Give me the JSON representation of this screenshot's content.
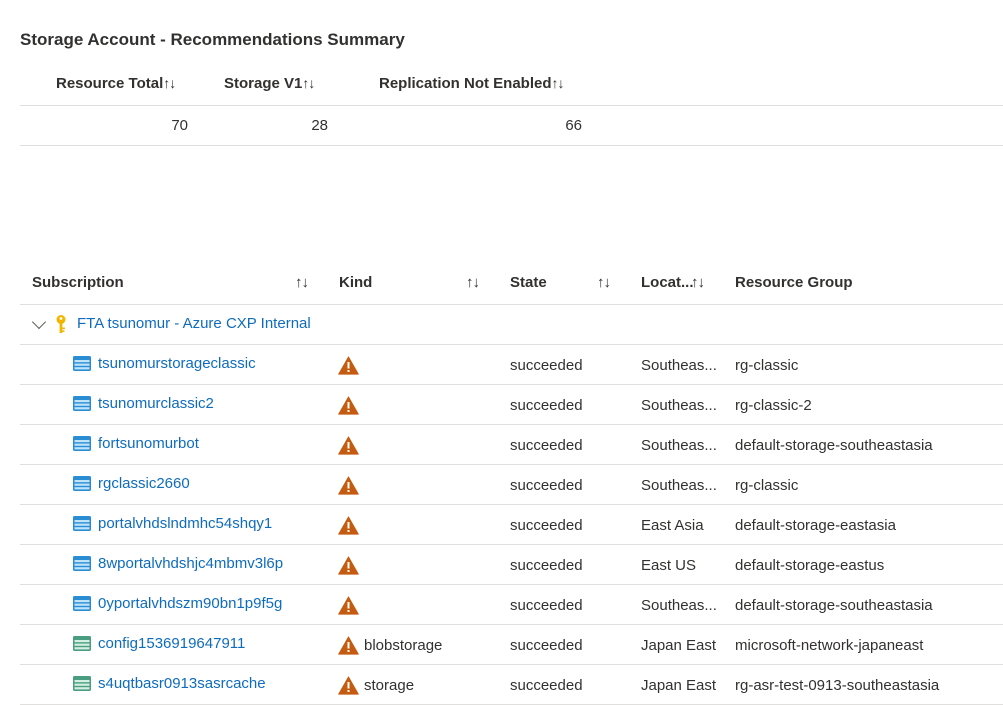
{
  "summary": {
    "title": "Storage Account - Recommendations Summary",
    "columns": [
      {
        "label": "Resource Total",
        "sort": "↑↓"
      },
      {
        "label": "Storage V1",
        "sort": "↑↓"
      },
      {
        "label": "Replication Not Enabled",
        "sort": "↑↓"
      }
    ],
    "values": [
      "70",
      "28",
      "66"
    ]
  },
  "grid": {
    "columns": [
      {
        "label": "Subscription",
        "sort": "↑↓"
      },
      {
        "label": "Kind",
        "sort": "↑↓"
      },
      {
        "label": "State",
        "sort": "↑↓"
      },
      {
        "label": "Locat...",
        "sort": "↑↓"
      },
      {
        "label": "Resource Group"
      }
    ],
    "group": {
      "label": "FTA tsunomur - Azure CXP Internal",
      "icon": "key-icon",
      "expanded": true
    },
    "rows": [
      {
        "name": "tsunomurstorageclassic",
        "icon": "storage-classic-icon",
        "kind": "",
        "state": "succeeded",
        "location": "Southeas...",
        "resource_group": "rg-classic"
      },
      {
        "name": "tsunomurclassic2",
        "icon": "storage-classic-icon",
        "kind": "",
        "state": "succeeded",
        "location": "Southeas...",
        "resource_group": "rg-classic-2"
      },
      {
        "name": "fortsunomurbot",
        "icon": "storage-classic-icon",
        "kind": "",
        "state": "succeeded",
        "location": "Southeas...",
        "resource_group": "default-storage-southeastasia"
      },
      {
        "name": "rgclassic2660",
        "icon": "storage-classic-icon",
        "kind": "",
        "state": "succeeded",
        "location": "Southeas...",
        "resource_group": "rg-classic"
      },
      {
        "name": "portalvhdslndmhc54shqy1",
        "icon": "storage-classic-icon",
        "kind": "",
        "state": "succeeded",
        "location": "East Asia",
        "resource_group": "default-storage-eastasia"
      },
      {
        "name": "8wportalvhdshjc4mbmv3l6p",
        "icon": "storage-classic-icon",
        "kind": "",
        "state": "succeeded",
        "location": "East US",
        "resource_group": "default-storage-eastus"
      },
      {
        "name": "0yportalvhdszm90bn1p9f5g",
        "icon": "storage-classic-icon",
        "kind": "",
        "state": "succeeded",
        "location": "Southeas...",
        "resource_group": "default-storage-southeastasia"
      },
      {
        "name": "config1536919647911",
        "icon": "storage-account-icon",
        "kind": "blobstorage",
        "state": "succeeded",
        "location": "Japan East",
        "resource_group": "microsoft-network-japaneast"
      },
      {
        "name": "s4uqtbasr0913sasrcache",
        "icon": "storage-account-icon",
        "kind": "storage",
        "state": "succeeded",
        "location": "Japan East",
        "resource_group": "rg-asr-test-0913-southeastasia"
      }
    ]
  },
  "colors": {
    "link": "#0f6cbd",
    "warning": "#c55a11",
    "key": "#f2b600",
    "classic_storage": "#2a8dd4",
    "storage_account": "#4a9e7f",
    "divider": "#e1dfdd"
  }
}
